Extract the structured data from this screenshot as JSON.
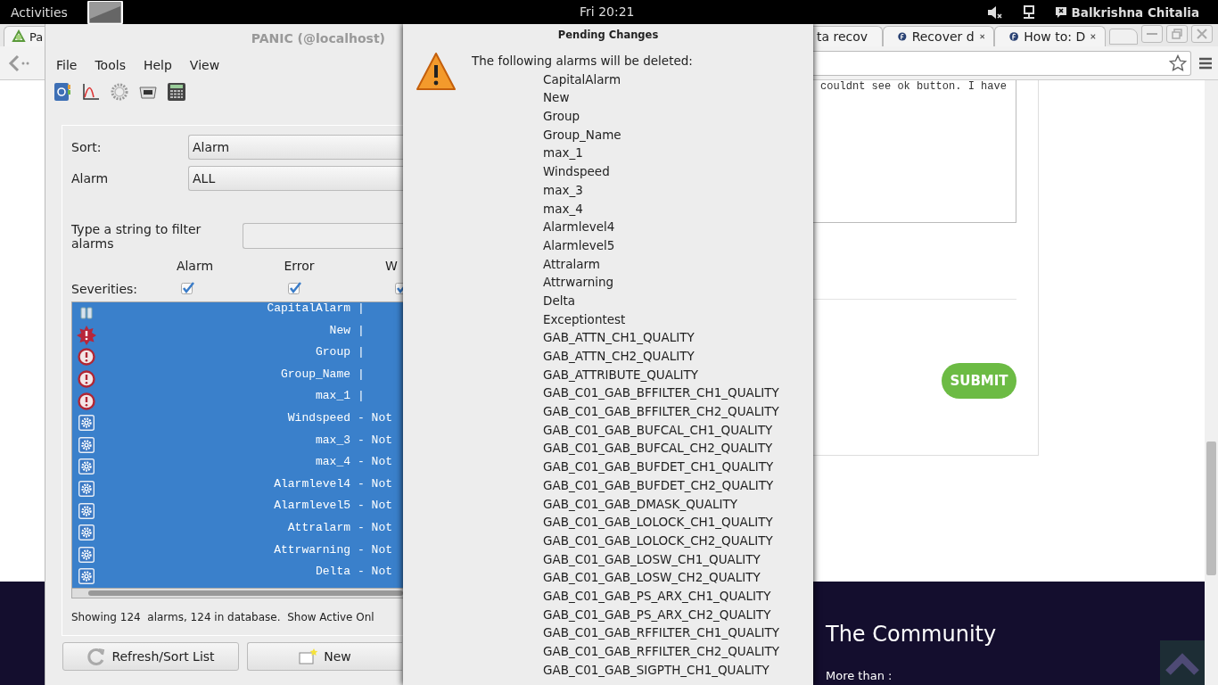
{
  "top_bar": {
    "activities": "Activities",
    "clock": "Fri 20:21",
    "user": "Balkrishna Chitalia"
  },
  "browser": {
    "tabs": [
      {
        "label": "Pa",
        "kind": "panic"
      },
      {
        "label": "ta recov",
        "kind": "none"
      },
      {
        "label": "Recover d",
        "kind": "fedora"
      },
      {
        "label": "How to: D",
        "kind": "fedora"
      }
    ],
    "comment_text": "couldnt see ok button. I have",
    "submit": "SUBMIT",
    "footer_heading": "The Community",
    "footer_text": "More than :"
  },
  "panic": {
    "title": "PANIC (@localhost)",
    "menu": [
      "File",
      "Tools",
      "Help",
      "View"
    ],
    "sort_label": "Sort:",
    "sort_value": "Alarm",
    "alarm_label": "Alarm",
    "alarm_value": "ALL",
    "filter_label": "Type a string to filter alarms",
    "severities_label": "Severities:",
    "severities": [
      {
        "label": "Alarm",
        "checked": true
      },
      {
        "label": "Error",
        "checked": true
      },
      {
        "label": "W",
        "checked": true
      }
    ],
    "rows": [
      {
        "name": "CapitalAlarm",
        "status": "|",
        "kind": "paused",
        "selected": true
      },
      {
        "name": "New",
        "status": "|",
        "kind": "new",
        "selected": true
      },
      {
        "name": "Group",
        "status": "|",
        "kind": "error",
        "selected": true
      },
      {
        "name": "Group_Name",
        "status": "|",
        "kind": "error",
        "selected": true
      },
      {
        "name": "max_1",
        "status": "|",
        "kind": "error",
        "selected": true
      },
      {
        "name": "Windspeed",
        "status": "- Not",
        "kind": "disabled",
        "selected": true
      },
      {
        "name": "max_3",
        "status": "- Not",
        "kind": "disabled",
        "selected": true
      },
      {
        "name": "max_4",
        "status": "- Not",
        "kind": "disabled",
        "selected": true
      },
      {
        "name": "Alarmlevel4",
        "status": "- Not",
        "kind": "disabled",
        "selected": true
      },
      {
        "name": "Alarmlevel5",
        "status": "- Not",
        "kind": "disabled",
        "selected": true
      },
      {
        "name": "Attralarm",
        "status": "- Not",
        "kind": "disabled",
        "selected": true
      },
      {
        "name": "Attrwarning",
        "status": "- Not",
        "kind": "disabled",
        "selected": true
      },
      {
        "name": "Delta",
        "status": "- Not",
        "kind": "disabled",
        "selected": true
      }
    ],
    "status": "Showing 124  alarms, 124 in database.  Show Active Onl",
    "buttons": [
      {
        "label": "Refresh/Sort List",
        "kind": "refresh"
      },
      {
        "label": "New",
        "kind": "new"
      }
    ]
  },
  "dialog": {
    "title": "Pending Changes",
    "message": "The following alarms will be deleted:",
    "items": [
      "CapitalAlarm",
      "New",
      "Group",
      "Group_Name",
      "max_1",
      "Windspeed",
      "max_3",
      "max_4",
      "Alarmlevel4",
      "Alarmlevel5",
      "Attralarm",
      "Attrwarning",
      "Delta",
      "Exceptiontest",
      "GAB_ATTN_CH1_QUALITY",
      "GAB_ATTN_CH2_QUALITY",
      "GAB_ATTRIBUTE_QUALITY",
      "GAB_C01_GAB_BFFILTER_CH1_QUALITY",
      "GAB_C01_GAB_BFFILTER_CH2_QUALITY",
      "GAB_C01_GAB_BUFCAL_CH1_QUALITY",
      "GAB_C01_GAB_BUFCAL_CH2_QUALITY",
      "GAB_C01_GAB_BUFDET_CH1_QUALITY",
      "GAB_C01_GAB_BUFDET_CH2_QUALITY",
      "GAB_C01_GAB_DMASK_QUALITY",
      "GAB_C01_GAB_LOLOCK_CH1_QUALITY",
      "GAB_C01_GAB_LOLOCK_CH2_QUALITY",
      "GAB_C01_GAB_LOSW_CH1_QUALITY",
      "GAB_C01_GAB_LOSW_CH2_QUALITY",
      "GAB_C01_GAB_PS_ARX_CH1_QUALITY",
      "GAB_C01_GAB_PS_ARX_CH2_QUALITY",
      "GAB_C01_GAB_RFFILTER_CH1_QUALITY",
      "GAB_C01_GAB_RFFILTER_CH2_QUALITY",
      "GAB_C01_GAB_SIGPTH_CH1_QUALITY"
    ]
  }
}
